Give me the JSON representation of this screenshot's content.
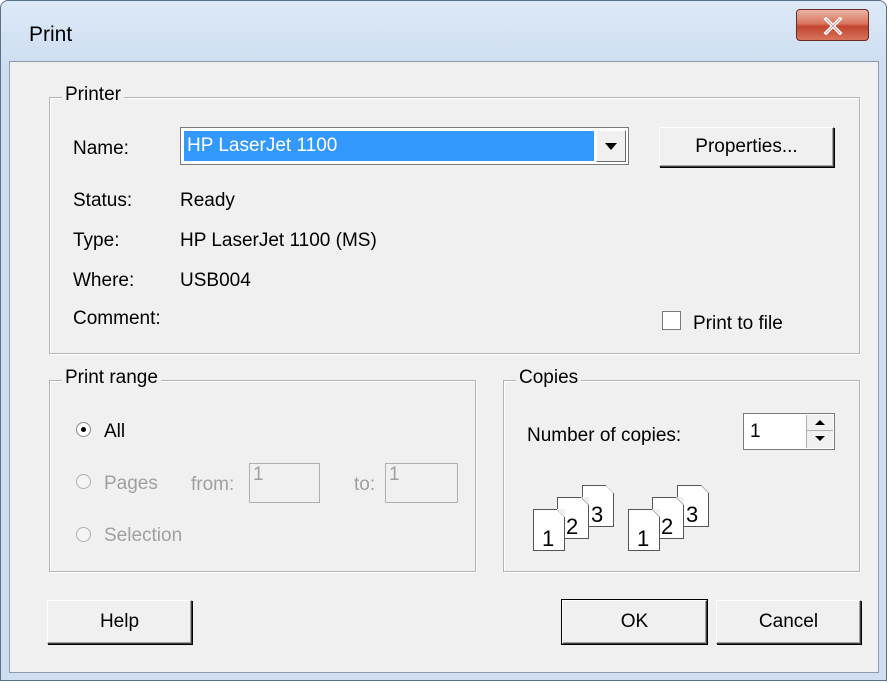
{
  "window": {
    "title": "Print"
  },
  "printer": {
    "group_label": "Printer",
    "name_label": "Name:",
    "name_value": "HP LaserJet 1100",
    "properties_button": "Properties...",
    "status_label": "Status:",
    "status_value": "Ready",
    "type_label": "Type:",
    "type_value": "HP LaserJet 1100 (MS)",
    "where_label": "Where:",
    "where_value": "USB004",
    "comment_label": "Comment:",
    "comment_value": "",
    "print_to_file_label": "Print to file",
    "print_to_file_checked": false
  },
  "print_range": {
    "group_label": "Print range",
    "all_label": "All",
    "pages_label": "Pages",
    "from_label": "from:",
    "from_value": "1",
    "to_label": "to:",
    "to_value": "1",
    "selection_label": "Selection",
    "selected": "All"
  },
  "copies": {
    "group_label": "Copies",
    "number_label": "Number of copies:",
    "number_value": "1",
    "collate_pages": [
      "1",
      "2",
      "3"
    ]
  },
  "buttons": {
    "help": "Help",
    "ok": "OK",
    "cancel": "Cancel"
  },
  "icons": {
    "close": "close-icon",
    "dropdown": "chevron-down-icon",
    "spin_up": "chevron-up-icon",
    "spin_down": "chevron-down-icon"
  },
  "colors": {
    "selection": "#3399ff",
    "close_button": "#c1452f",
    "dialog_bg": "#f0f0f0"
  }
}
